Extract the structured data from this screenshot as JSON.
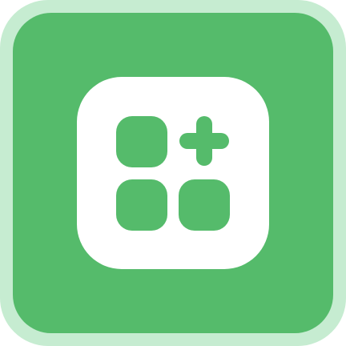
{
  "icon": {
    "semantic_name": "add-apps-icon",
    "colors": {
      "outer_border": "#c6ecd1",
      "background": "#55bb6b",
      "tile": "#ffffff",
      "glyph": "#55bb6b"
    }
  }
}
